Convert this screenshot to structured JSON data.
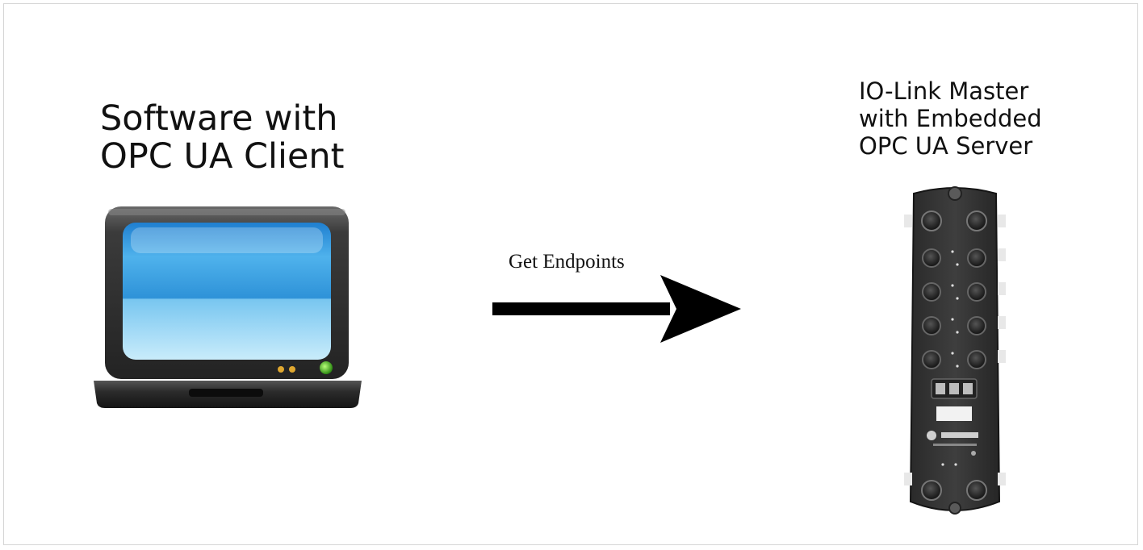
{
  "client": {
    "title_line1": "Software with",
    "title_line2": "OPC UA Client"
  },
  "server": {
    "title_line1": "IO-Link Master",
    "title_line2": "with Embedded",
    "title_line3": "OPC UA Server"
  },
  "arrow": {
    "label": "Get Endpoints"
  }
}
